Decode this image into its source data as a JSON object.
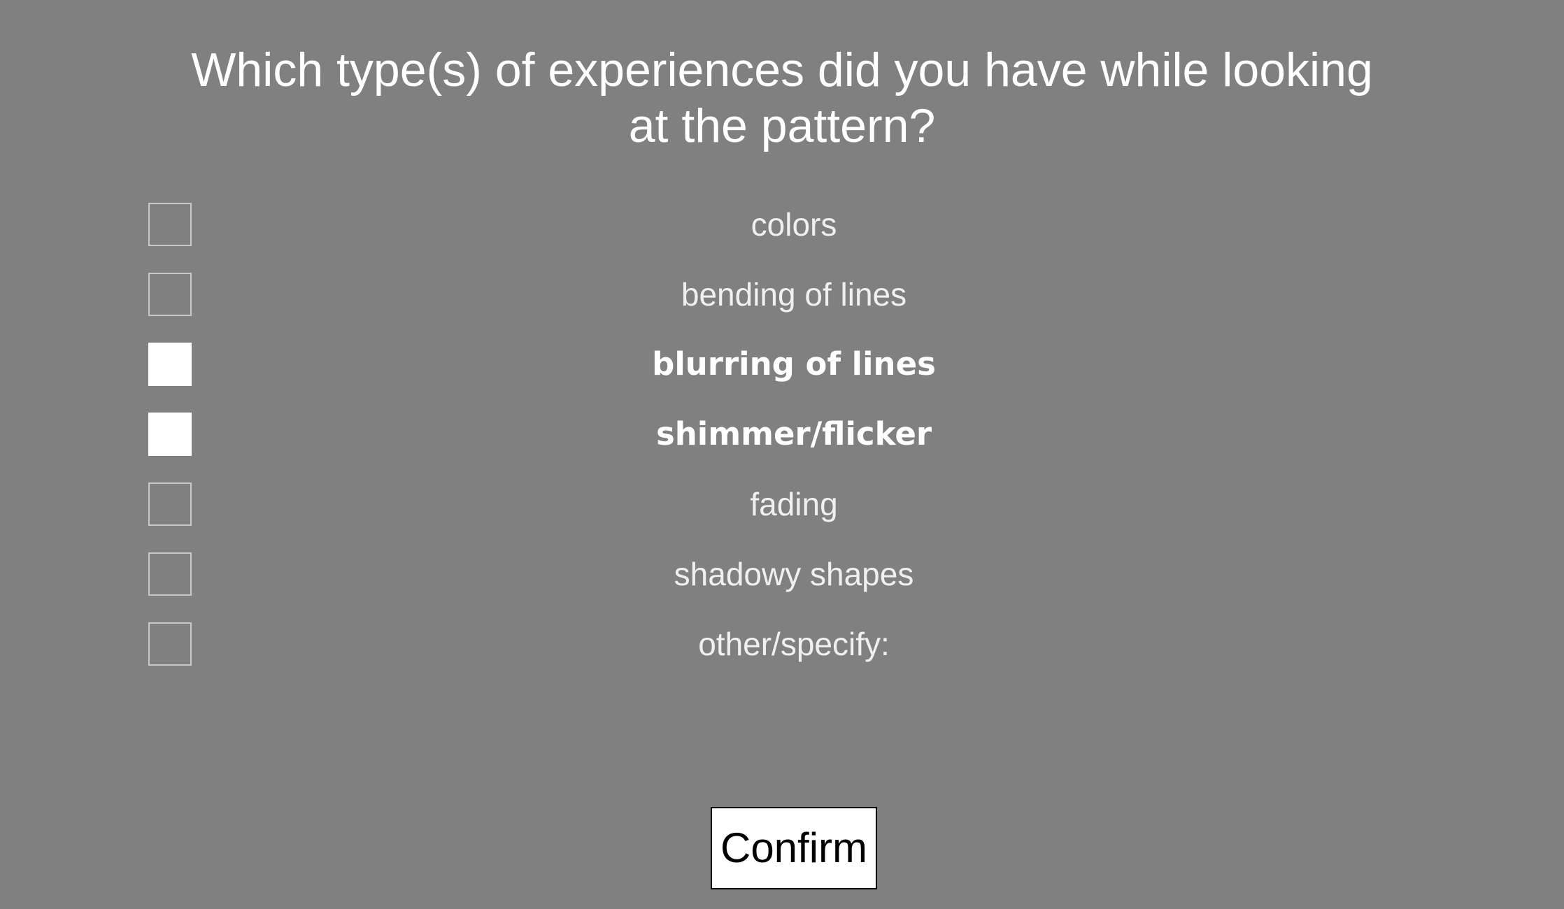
{
  "question": {
    "line1": "Which type(s) of experiences did you have while looking",
    "line2": "at the pattern?"
  },
  "options": [
    {
      "label": "colors",
      "checked": false
    },
    {
      "label": "bending of lines",
      "checked": false
    },
    {
      "label": "blurring of lines",
      "checked": true
    },
    {
      "label": "shimmer/flicker",
      "checked": true
    },
    {
      "label": "fading",
      "checked": false
    },
    {
      "label": "shadowy shapes",
      "checked": false
    },
    {
      "label": "other/specify:",
      "checked": false
    }
  ],
  "confirm_label": "Confirm",
  "colors": {
    "background": "#808080",
    "checked_fill": "#ffffff",
    "text": "#ffffff"
  }
}
